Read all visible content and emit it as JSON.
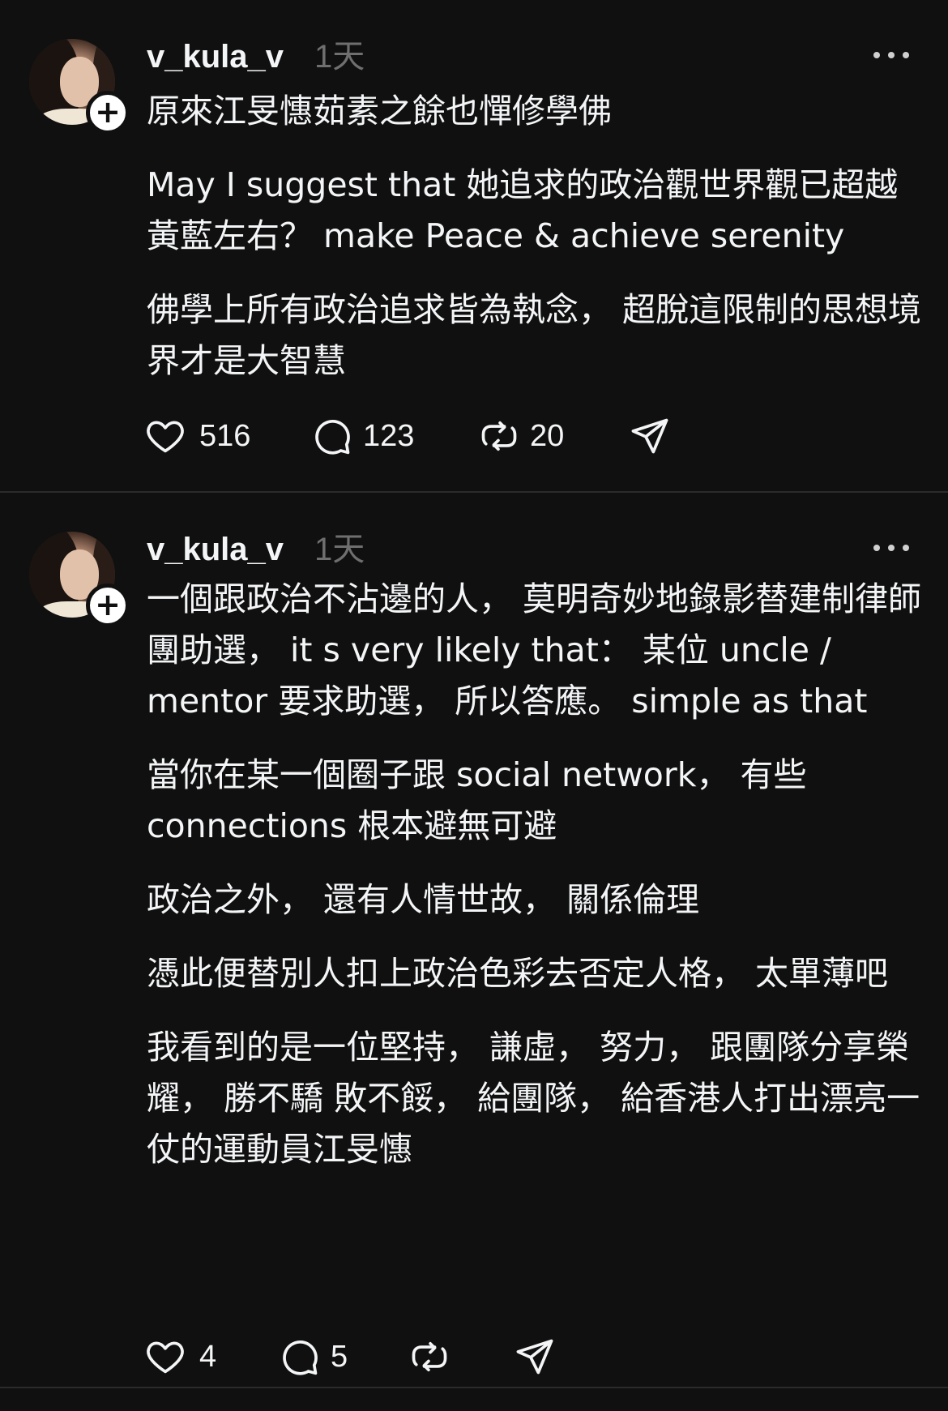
{
  "colors": {
    "background": "#101010",
    "text": "#f3f5f7",
    "timestamp": "#6f6f6f",
    "divider": "#2b2b2b"
  },
  "posts": [
    {
      "username": "v_kula_v",
      "timestamp": "1天",
      "paragraphs": [
        "原來江旻憓茹素之餘也憚修學佛",
        "May I suggest that 她追求的政治觀世界觀已超越黃藍左右？ make Peace & achieve serenity",
        "佛學上所有政治追求皆為執念， 超脫這限制的思想境界才是大智慧"
      ],
      "likes": "516",
      "replies": "123",
      "reposts": "20",
      "icons": [
        "heart-icon",
        "comment-icon",
        "repost-icon",
        "share-icon",
        "more-icon",
        "follow-plus-icon"
      ]
    },
    {
      "username": "v_kula_v",
      "timestamp": "1天",
      "paragraphs": [
        "一個跟政治不沾邊的人， 莫明奇妙地錄影替建制律師團助選， it s very likely that： 某位 uncle / mentor 要求助選， 所以答應。 simple as that",
        "當你在某一個圈子跟 social network， 有些 connections 根本避無可避",
        "政治之外， 還有人情世故， 關係倫理",
        "憑此便替別人扣上政治色彩去否定人格， 太單薄吧",
        "我看到的是一位堅持， 謙虛， 努力， 跟團隊分享榮耀， 勝不驕 敗不餒， 給團隊， 給香港人打出漂亮一仗的運動員江旻憓"
      ],
      "likes": "4",
      "replies": "5",
      "reposts": "",
      "icons": [
        "heart-icon",
        "comment-icon",
        "repost-icon",
        "share-icon",
        "more-icon",
        "follow-plus-icon"
      ]
    }
  ]
}
